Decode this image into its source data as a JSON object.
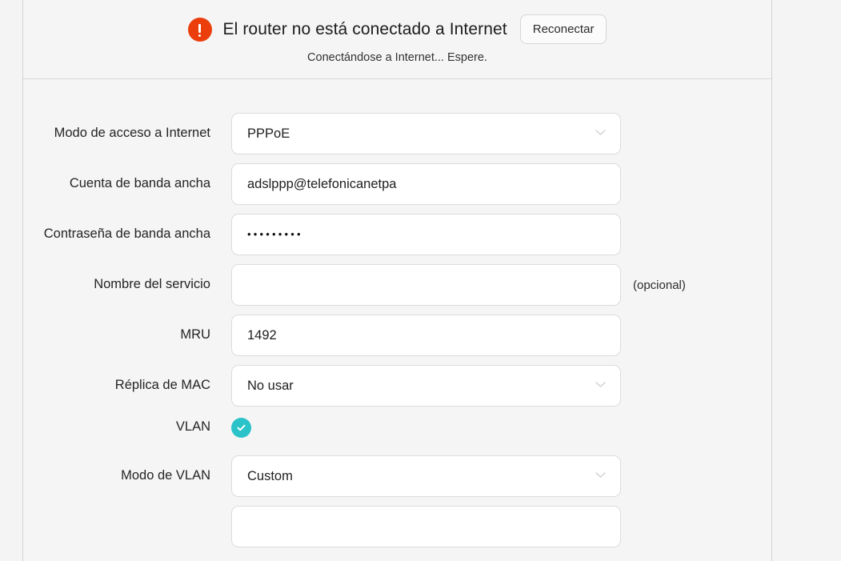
{
  "status": {
    "icon": "alert-circle-icon",
    "title": "El router no está conectado a Internet",
    "reconnect_label": "Reconectar",
    "subtitle": "Conectándose a Internet... Espere.",
    "alert_color": "#ec3e0c"
  },
  "form": {
    "rows": [
      {
        "id": "internet-access-mode",
        "label": "Modo de acceso a Internet",
        "type": "select",
        "value": "PPPoE",
        "suffix": ""
      },
      {
        "id": "broadband-account",
        "label": "Cuenta de banda ancha",
        "type": "text",
        "value": "adslppp@telefonicanetpa",
        "placeholder": "",
        "suffix": ""
      },
      {
        "id": "broadband-password",
        "label": "Contraseña de banda ancha",
        "type": "password",
        "value": "•••••••••",
        "suffix": ""
      },
      {
        "id": "service-name",
        "label": "Nombre del servicio",
        "type": "text",
        "value": "",
        "placeholder": "",
        "suffix": "(opcional)"
      },
      {
        "id": "mru",
        "label": "MRU",
        "type": "text",
        "value": "1492",
        "placeholder": "",
        "suffix": ""
      },
      {
        "id": "mac-clone",
        "label": "Réplica de MAC",
        "type": "select",
        "value": "No usar",
        "suffix": ""
      },
      {
        "id": "vlan",
        "label": "VLAN",
        "type": "checkbox",
        "checked": true,
        "suffix": ""
      },
      {
        "id": "vlan-mode",
        "label": "Modo de VLAN",
        "type": "select",
        "value": "Custom",
        "suffix": ""
      }
    ]
  },
  "colors": {
    "accent_teal": "#2ac3c9",
    "alert_orange": "#ec3e0c",
    "panel_bg": "#f5f5f5",
    "field_bg": "#ffffff",
    "field_border": "#dcdcdc"
  }
}
